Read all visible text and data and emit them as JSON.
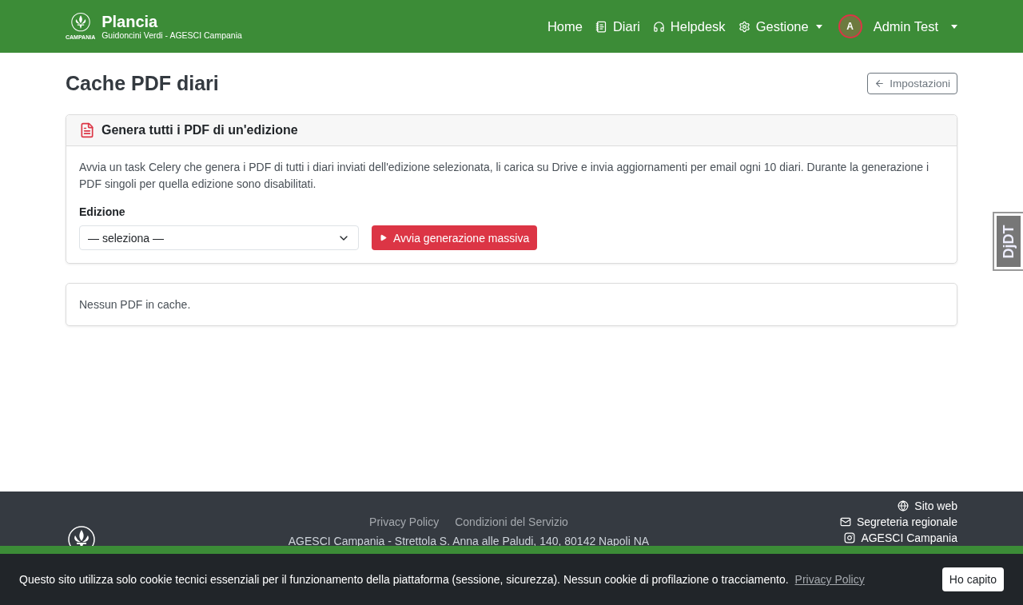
{
  "navbar": {
    "brand": "Plancia",
    "subtitle": "Guidoncini Verdi - AGESCI Campania",
    "logo_caption": "CAMPANIA",
    "links": [
      {
        "kind": "plain",
        "label": "Home"
      },
      {
        "kind": "notebook",
        "label": "Diari"
      },
      {
        "kind": "headset",
        "label": "Helpdesk"
      },
      {
        "kind": "gear",
        "label": "Gestione",
        "dropdown": true
      }
    ],
    "user": {
      "initial": "A",
      "name": "Admin Test"
    }
  },
  "page": {
    "title": "Cache PDF diari",
    "back_button": "Impostazioni"
  },
  "generate_card": {
    "title": "Genera tutti i PDF di un'edizione",
    "description": "Avvia un task Celery che genera i PDF di tutti i diari inviati dell'edizione selezionata, li carica su Drive e invia aggiornamenti per email ogni 10 diari. Durante la generazione i PDF singoli per quella edizione sono disabilitati.",
    "field_label": "Edizione",
    "select_value": "— seleziona —",
    "button": "Avvia generazione massiva"
  },
  "cache_card": {
    "message": "Nessun PDF in cache."
  },
  "debug_toolbar": {
    "label": "DjDT"
  },
  "footer": {
    "links": [
      "Privacy Policy",
      "Condizioni del Servizio"
    ],
    "address": "AGESCI Campania - Strettola S. Anna alle Paludi, 140, 80142 Napoli NA",
    "contacts": [
      {
        "kind": "globe",
        "label": "Sito web"
      },
      {
        "kind": "mail",
        "label": "Segreteria regionale"
      },
      {
        "kind": "instagram",
        "label": "AGESCI Campania"
      }
    ]
  },
  "cookie_banner": {
    "message": "Questo sito utilizza solo cookie tecnici essenziali per il funzionamento della piattaforma (sessione, sicurezza). Nessun cookie di profilazione o tracciamento.",
    "link": "Privacy Policy",
    "button": "Ho capito"
  }
}
